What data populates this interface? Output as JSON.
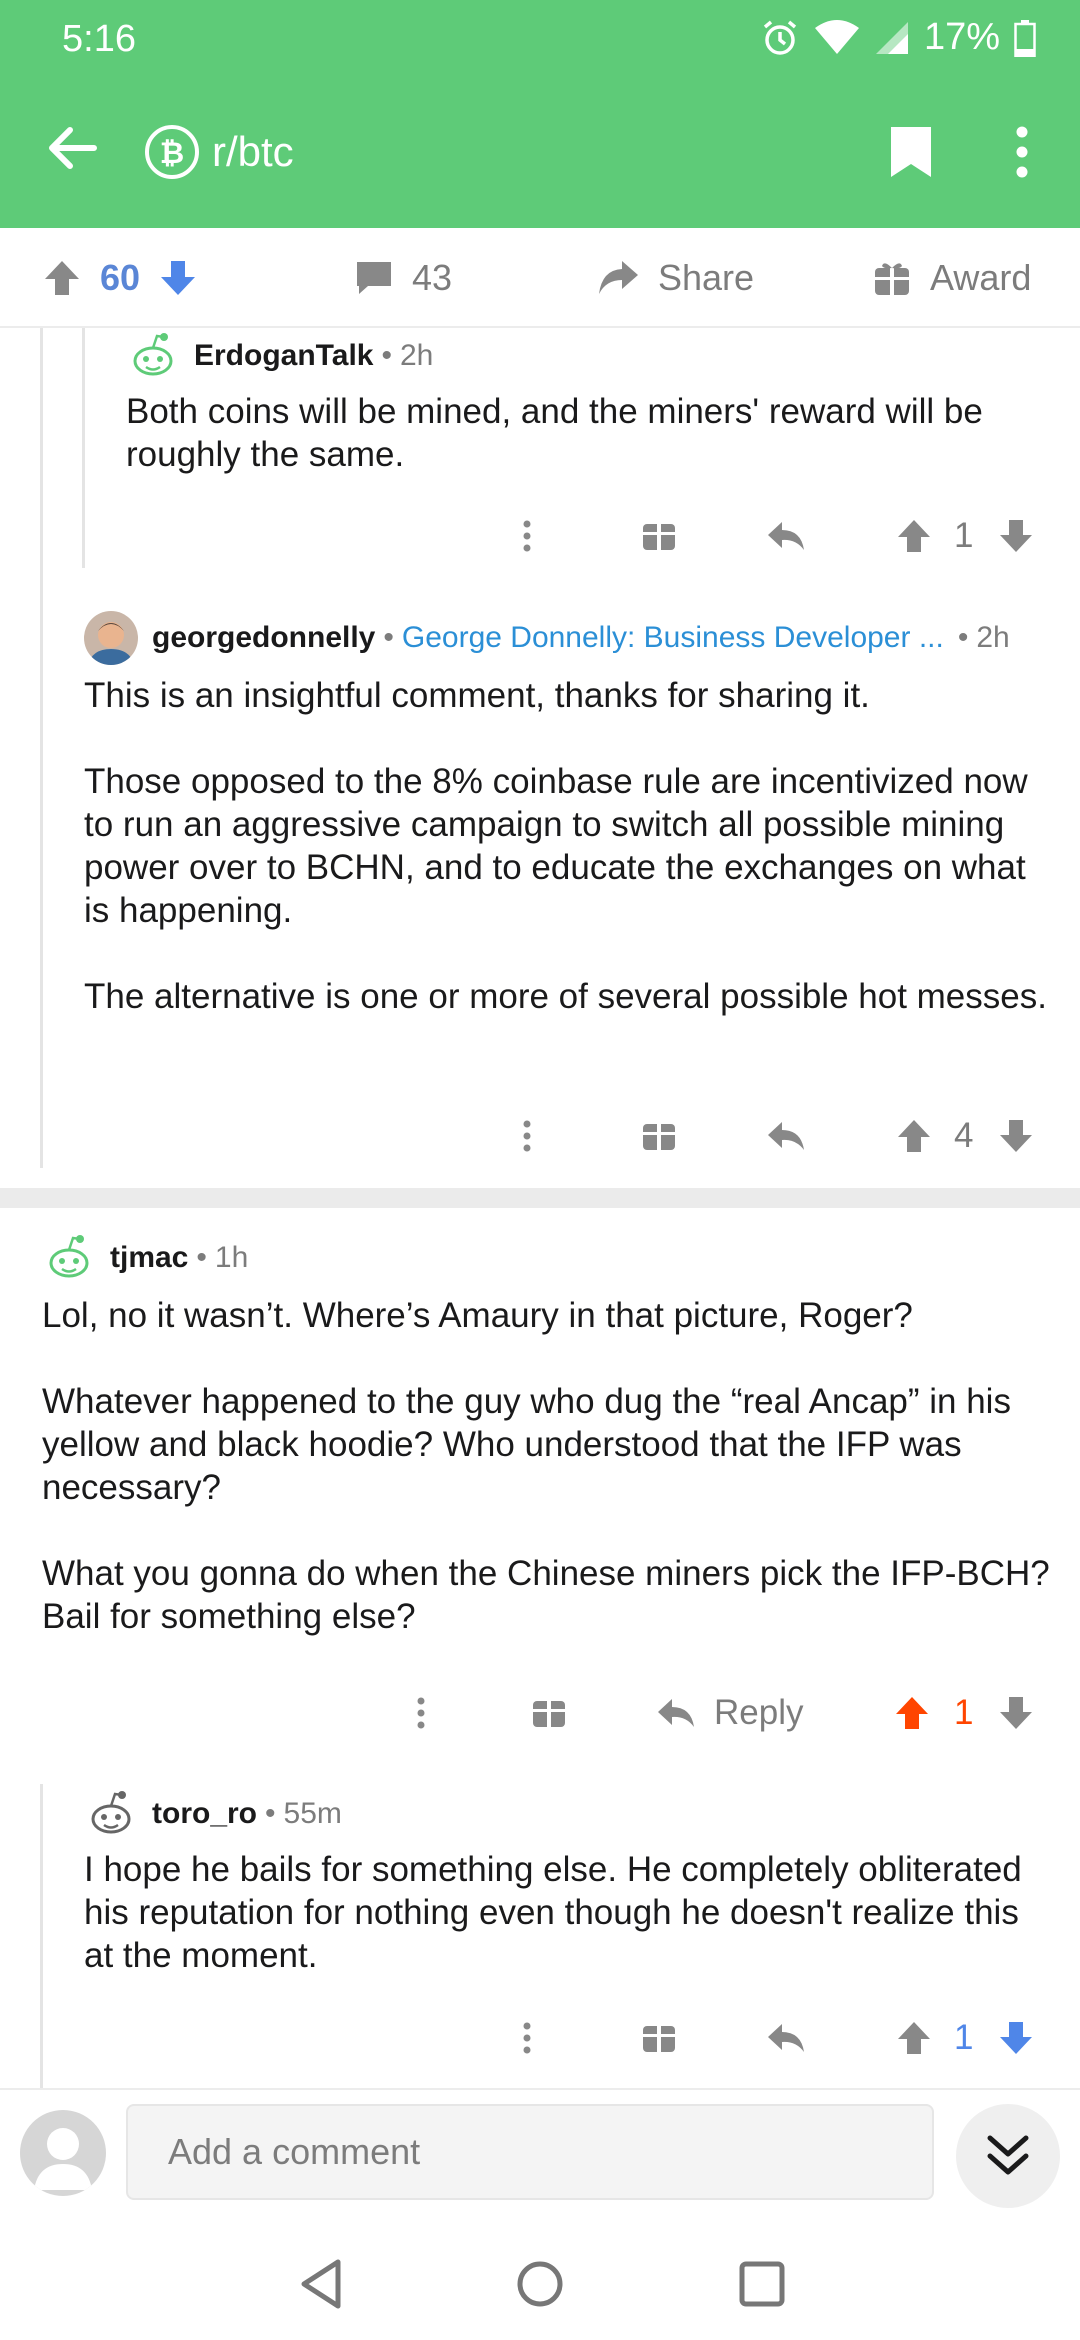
{
  "status_bar": {
    "time": "5:16",
    "battery": "17%"
  },
  "header": {
    "subreddit": "r/btc"
  },
  "post_actions": {
    "upvotes": "60",
    "comments": "43",
    "share": "Share",
    "award": "Award"
  },
  "comments": [
    {
      "author": "ErdoganTalk",
      "age": "2h",
      "body": [
        "Both coins will be mined, and the miners' reward will be roughly the same."
      ],
      "score": "1"
    },
    {
      "author": "georgedonnelly",
      "flair": "George Donnelly: Business Developer ...",
      "age": "2h",
      "body": [
        "This is an insightful comment, thanks for sharing it.",
        "Those opposed to the 8% coinbase rule are incentivized now to run an aggressive campaign to switch all possible mining power over to BCHN, and to educate the exchanges on what is happening.",
        "The alternative is one or more of several possible hot messes."
      ],
      "score": "4"
    },
    {
      "author": "tjmac",
      "age": "1h",
      "body": [
        "Lol, no it wasn’t. Where’s Amaury in that picture, Roger?",
        "Whatever happened to the guy who dug the “real Ancap” in his yellow and black hoodie? Who understood that the IFP was necessary?",
        "What you gonna do when the Chinese miners pick the IFP-BCH? Bail for something else?"
      ],
      "reply_label": "Reply",
      "score": "1"
    },
    {
      "author": "toro_ro",
      "age": "55m",
      "body": [
        "I hope he bails for something else. He completely obliterated his reputation for nothing even though he doesn't realize this at the moment."
      ],
      "score": "1"
    }
  ],
  "compose": {
    "placeholder": "Add a comment"
  },
  "colors": {
    "brand": "#5ecb78",
    "upvoted": "#ff4500",
    "downvoted": "#4f86e8",
    "flair": "#2b8fd6"
  }
}
